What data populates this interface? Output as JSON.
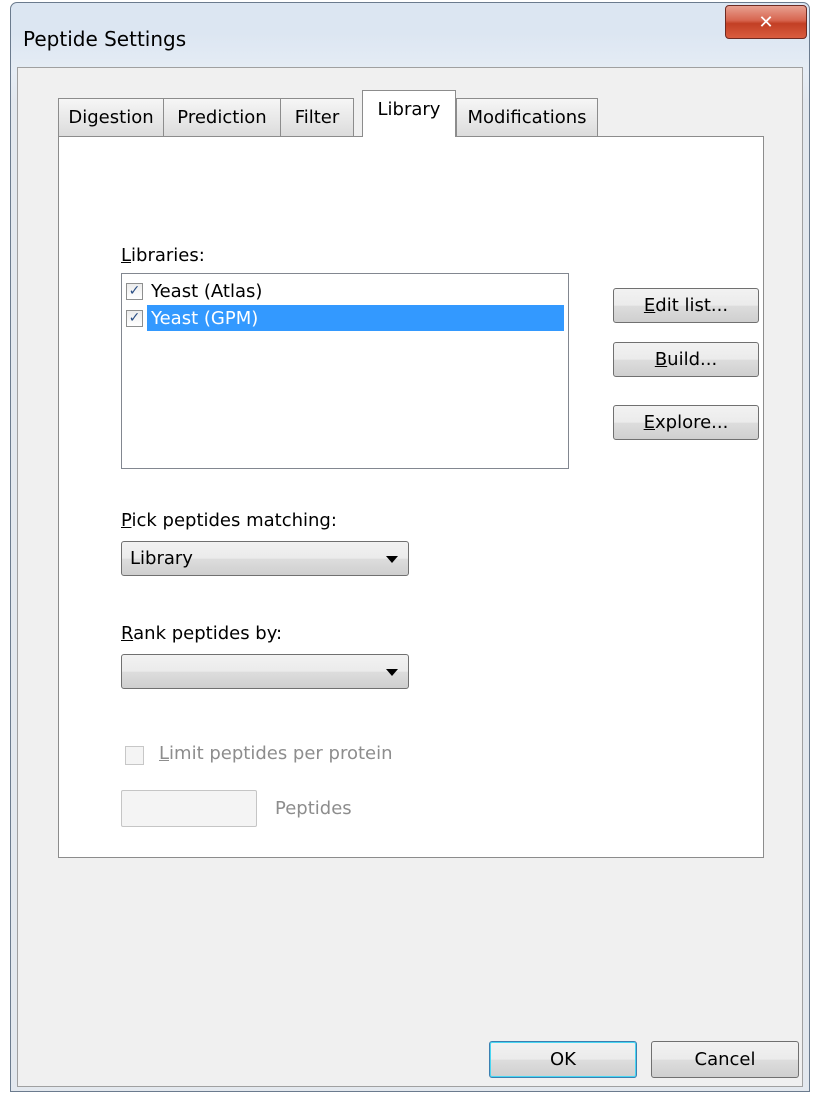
{
  "window": {
    "title": "Peptide Settings",
    "close_glyph": "✕"
  },
  "tabs": [
    {
      "label": "Digestion",
      "active": false
    },
    {
      "label": "Prediction",
      "active": false
    },
    {
      "label": "Filter",
      "active": false
    },
    {
      "label": "Library",
      "active": true
    },
    {
      "label": "Modifications",
      "active": false
    }
  ],
  "library_tab": {
    "libraries_label": {
      "mnemonic": "L",
      "rest": "ibraries:"
    },
    "libraries": [
      {
        "name": "Yeast (Atlas)",
        "checked": true,
        "selected": false
      },
      {
        "name": "Yeast (GPM)",
        "checked": true,
        "selected": true
      }
    ],
    "buttons": {
      "edit_list": {
        "mnemonic": "E",
        "rest": "dit list..."
      },
      "build": {
        "mnemonic": "B",
        "rest": "uild..."
      },
      "explore": {
        "mnemonic": "E",
        "rest": "xplore..."
      }
    },
    "pick_label": {
      "mnemonic": "P",
      "rest": "ick peptides matching:"
    },
    "pick_value": "Library",
    "rank_label": {
      "mnemonic": "R",
      "rest": "ank peptides by:"
    },
    "rank_value": "",
    "limit_label": {
      "mnemonic": "L",
      "rest": "imit peptides per protein"
    },
    "limit_checked": false,
    "peptides_value": "",
    "peptides_unit": "Peptides"
  },
  "footer": {
    "ok": "OK",
    "cancel": "Cancel"
  },
  "icons": {
    "checkmark": "✓"
  },
  "colors": {
    "selection": "#3399ff",
    "disabled_text": "#8d8d8d",
    "close_button": "#c23f24"
  }
}
